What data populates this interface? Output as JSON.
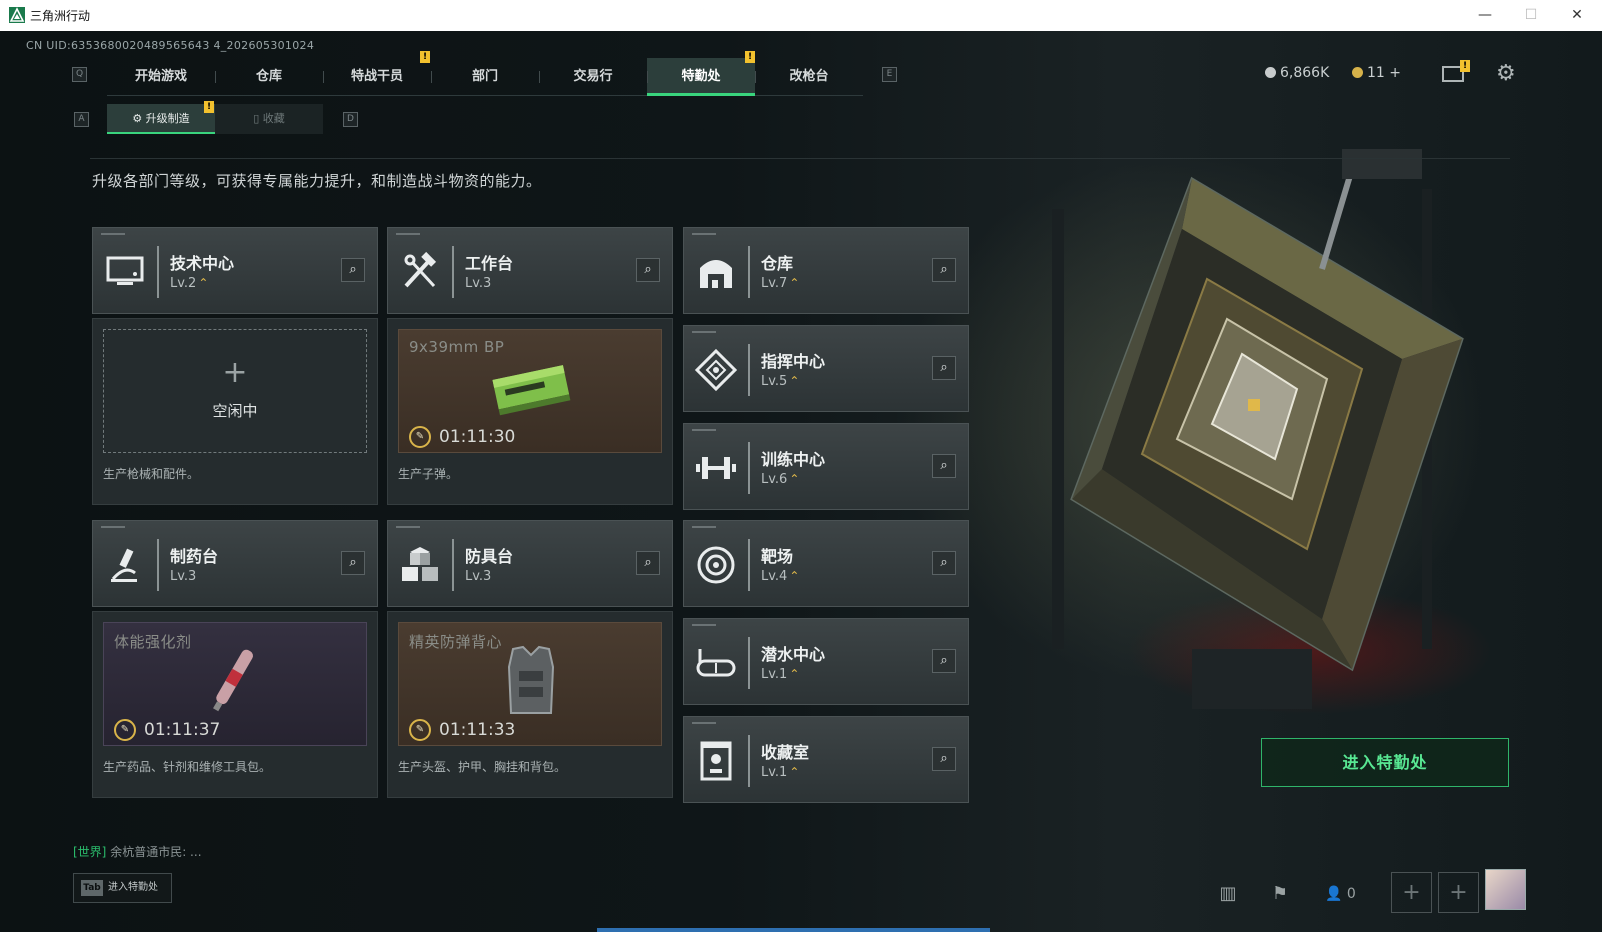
{
  "window": {
    "title": "三角洲行动",
    "minimize": "—",
    "maximize": "☐",
    "close": "✕"
  },
  "uid": "CN UID:6353680020489565643 4_202605301024",
  "top_nav": {
    "key_left": "Q",
    "key_right": "E",
    "tabs": [
      {
        "label": "开始游戏",
        "active": false
      },
      {
        "label": "仓库",
        "active": false
      },
      {
        "label": "特战干员",
        "active": false
      },
      {
        "label": "部门",
        "active": false
      },
      {
        "label": "交易行",
        "active": false
      },
      {
        "label": "特勤处",
        "active": true
      },
      {
        "label": "改枪台",
        "active": false
      }
    ],
    "alert_mark": "!"
  },
  "currency": {
    "silver": "6,866K",
    "gold": "11",
    "plus": "+"
  },
  "sub_nav": {
    "key_left": "A",
    "key_right": "D",
    "tabs": [
      {
        "label": "升级制造",
        "active": true
      },
      {
        "label": "收藏",
        "active": false
      }
    ]
  },
  "description": "升级各部门等级，可获得专属能力提升，和制造战斗物资的能力。",
  "departments": {
    "tech": {
      "name": "技术中心",
      "level": "Lv.2",
      "icon": "monitor-icon"
    },
    "workbench": {
      "name": "工作台",
      "level": "Lv.3",
      "icon": "tools-icon"
    },
    "warehouse": {
      "name": "仓库",
      "level": "Lv.7",
      "icon": "vault-icon"
    },
    "command": {
      "name": "指挥中心",
      "level": "Lv.5",
      "icon": "command-icon"
    },
    "training": {
      "name": "训练中心",
      "level": "Lv.6",
      "icon": "dumbbell-icon"
    },
    "pharmacy": {
      "name": "制药台",
      "level": "Lv.3",
      "icon": "microscope-icon"
    },
    "armor": {
      "name": "防具台",
      "level": "Lv.3",
      "icon": "cubes-icon"
    },
    "range": {
      "name": "靶场",
      "level": "Lv.4",
      "icon": "target-icon"
    },
    "diving": {
      "name": "潜水中心",
      "level": "Lv.1",
      "icon": "goggles-icon"
    },
    "collection": {
      "name": "收藏室",
      "level": "Lv.1",
      "icon": "display-case-icon"
    }
  },
  "production": {
    "tech": {
      "status": "空闲中",
      "note": "生产枪械和配件。"
    },
    "workbench": {
      "item": "9x39mm BP",
      "timer": "01:11:30",
      "note": "生产子弹。"
    },
    "pharmacy": {
      "item": "体能强化剂",
      "timer": "01:11:37",
      "note": "生产药品、针剂和维修工具包。"
    },
    "armor": {
      "item": "精英防弹背心",
      "timer": "01:11:33",
      "note": "生产头盔、护甲、胸挂和背包。"
    }
  },
  "enter_button": "进入特勤处",
  "chat": {
    "channel": "[世界]",
    "text": "余杭普通市民: ..."
  },
  "tab_hint": {
    "key": "Tab",
    "label": "进入特勤处"
  },
  "bottom": {
    "friends_count": "0"
  },
  "colors": {
    "accent": "#39d47d",
    "alert": "#f2c12e",
    "upgrade": "#e0b84a"
  }
}
